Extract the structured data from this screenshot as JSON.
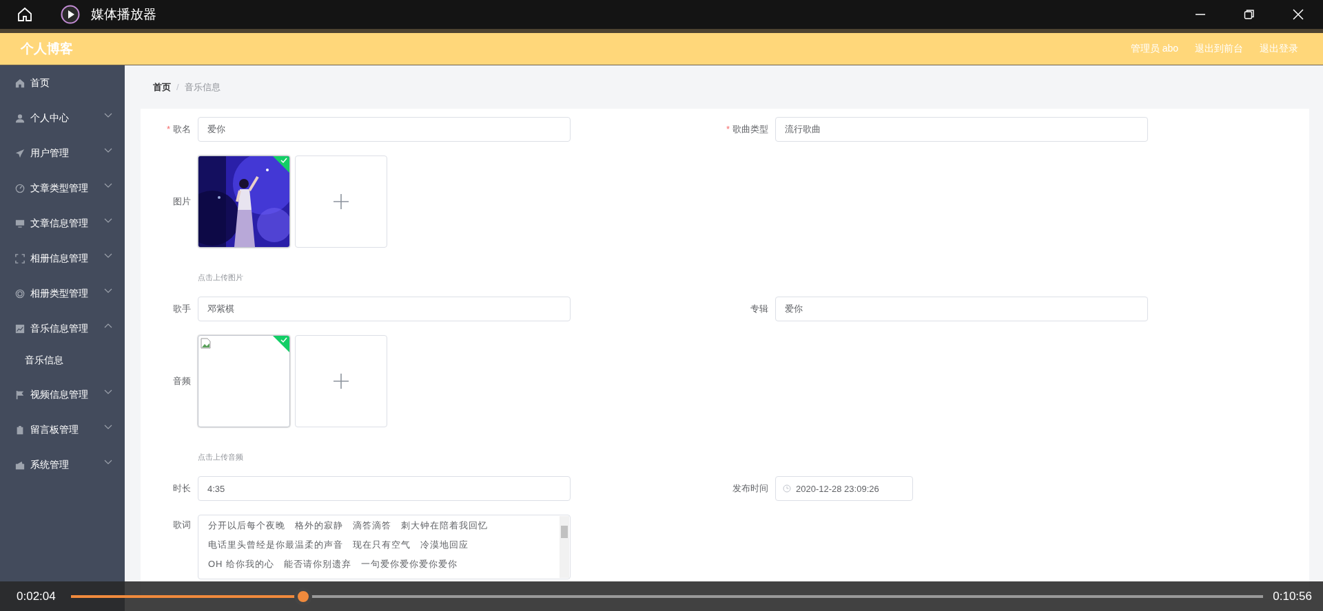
{
  "window": {
    "title": "媒体播放器"
  },
  "header": {
    "brand": "个人博客",
    "links": [
      "管理员 abo",
      "退出到前台",
      "退出登录"
    ]
  },
  "sidebar": {
    "items": [
      {
        "label": "首页",
        "kind": "link"
      },
      {
        "label": "个人中心",
        "kind": "submenu",
        "expanded": false
      },
      {
        "label": "用户管理",
        "kind": "submenu",
        "expanded": false
      },
      {
        "label": "文章类型管理",
        "kind": "submenu",
        "expanded": false
      },
      {
        "label": "文章信息管理",
        "kind": "submenu",
        "expanded": false
      },
      {
        "label": "相册信息管理",
        "kind": "submenu",
        "expanded": false
      },
      {
        "label": "相册类型管理",
        "kind": "submenu",
        "expanded": false
      },
      {
        "label": "音乐信息管理",
        "kind": "submenu",
        "expanded": true,
        "children": [
          {
            "label": "音乐信息",
            "selected": true
          }
        ]
      },
      {
        "label": "视频信息管理",
        "kind": "submenu",
        "expanded": false
      },
      {
        "label": "留言板管理",
        "kind": "submenu",
        "expanded": false
      },
      {
        "label": "系统管理",
        "kind": "submenu",
        "expanded": false
      }
    ]
  },
  "breadcrumb": {
    "items": [
      "首页",
      "音乐信息"
    ],
    "separator": "/"
  },
  "form": {
    "rows": [
      {
        "kind": "inputs",
        "fields": [
          {
            "label": "歌名",
            "required_mark": "*",
            "value": "爱你"
          },
          {
            "label": "歌曲类型",
            "required_mark": "*",
            "value": "流行歌曲"
          }
        ]
      },
      {
        "kind": "upload",
        "label": "图片",
        "file": {
          "kind": "picture",
          "uploaded": true
        },
        "hint": "点击上传图片"
      },
      {
        "kind": "inputs",
        "fields": [
          {
            "label": "歌手",
            "value": "邓紫棋"
          },
          {
            "label": "专辑",
            "value": "爱你"
          }
        ]
      },
      {
        "kind": "upload",
        "label": "音频",
        "file": {
          "kind": "broken",
          "uploaded": true
        },
        "hint": "点击上传音频"
      },
      {
        "kind": "inputs",
        "fields": [
          {
            "label": "时长",
            "value": "4:35"
          },
          {
            "label": "发布时间",
            "value": "2020-12-28 23:09:26",
            "kind": "datetime"
          }
        ]
      },
      {
        "kind": "textarea",
        "label": "歌词",
        "lines": [
          "分开以后每个夜晚　格外的寂静　滴答滴答　刺大钟在陪着我回忆",
          "电话里头曾经是你最温柔的声音　现在只有空气　冷漠地回应",
          "OH 给你我的心　能否请你别遗弃　一句爱你爱你爱你爱你"
        ]
      }
    ]
  },
  "player": {
    "elapsed": "0:02:04",
    "total": "0:10:56",
    "level": 0.19
  }
}
